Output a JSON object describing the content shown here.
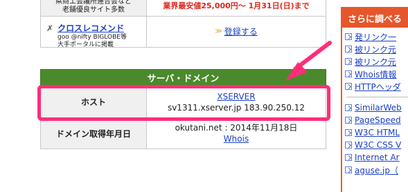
{
  "top_table": {
    "row1_label": "県商工会議所連合会など\n老舗優良サイト多数",
    "row1_value": "業界最安値25,000円〜 1月31日(日)まで",
    "row2_link": "クロスレコメンド",
    "row2_sub1": "goo @nifty BIGLOBE等",
    "row2_sub2": "大手ポータルに掲載",
    "row2_action": "登録する"
  },
  "server_section": {
    "header": "サーバ・ドメイン",
    "host_label": "ホスト",
    "host_link": "XSERVER",
    "host_value": "sv1311.xserver.jp 183.90.250.12",
    "domain_label": "ドメイン取得年月日",
    "domain_value": "okutani.net : 2014年11月18日",
    "domain_link": "Whois"
  },
  "sidebar": {
    "title": "さらに調べる",
    "items_group1": [
      "発リンク一",
      "被リンク元",
      "被リンク元",
      "Whois情報",
      "HTTPヘッダ"
    ],
    "items_group2": [
      "SimilarWeb",
      "PageSpeed",
      "W3C HTML",
      "W3C CSS V",
      "Internet Ar",
      "aguse.jp（"
    ]
  },
  "colors": {
    "highlight": "#ff2d7a",
    "section_header": "#4b8a2c",
    "sidebar_accent": "#e5562b",
    "link": "#1a3fc4",
    "price_red": "#e0261b"
  }
}
